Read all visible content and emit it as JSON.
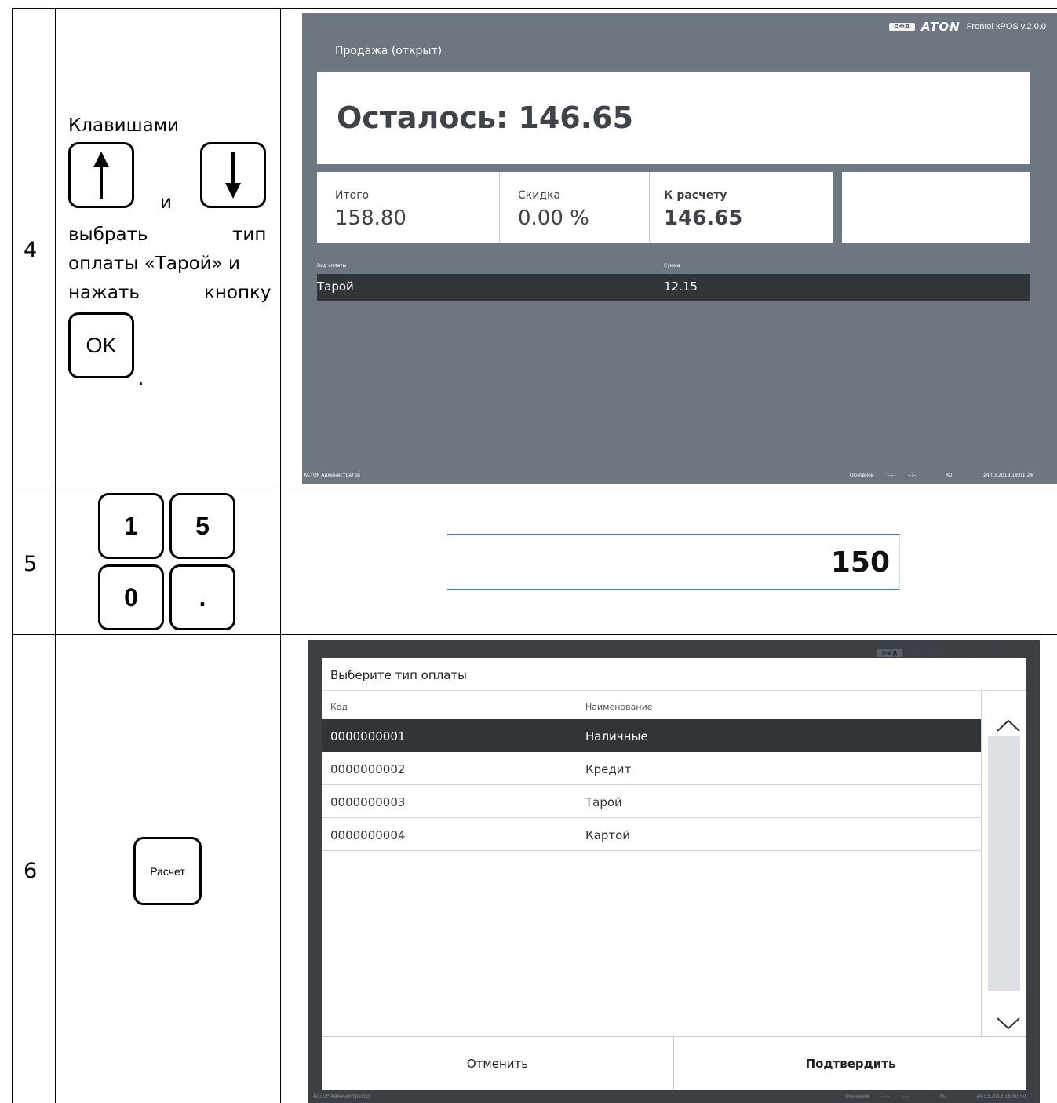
{
  "rows": [
    {
      "step": "4",
      "instruction": {
        "line1": "Клавишами",
        "and_word": "и",
        "line3_left": "выбрать",
        "line3_right": "тип",
        "line4": "оплаты «Тарой» и",
        "line5_left": "нажать",
        "line5_right": "кнопку",
        "ok_key": "OK",
        "period": "."
      },
      "keys": [
        "arrow-up-icon",
        "arrow-down-icon"
      ],
      "screen": {
        "brand": {
          "ofd_badge": "ОФД",
          "logo": "ATON",
          "version": "Frontol xPOS v.2.0.0"
        },
        "title": "Продажа (открыт)",
        "remaining": "Осталось: 146.65",
        "totals": [
          {
            "label": "Итого",
            "value": "158.80"
          },
          {
            "label": "Скидка",
            "value": "0.00 %"
          },
          {
            "label": "К расчету",
            "value": "146.65"
          }
        ],
        "payments_header": {
          "type": "Вид оплаты",
          "sum": "Сумма"
        },
        "payments": [
          {
            "type": "Тарой",
            "sum": "12.15"
          }
        ],
        "status": {
          "user": "АСТОР  Администратор",
          "mode": "Основной",
          "t1": "--:--",
          "t2": "--:--",
          "lang": "RU",
          "datetime": "24.03.2018 18:01:24"
        }
      }
    },
    {
      "step": "5",
      "keys": [
        "1",
        "5",
        "0",
        "."
      ],
      "amount": "150"
    },
    {
      "step": "6",
      "key_label": "Расчет",
      "screen": {
        "brand": {
          "ofd_badge": "ОФД",
          "logo": "ATON",
          "version": "Frontol xPOS v.2.0.0"
        },
        "dialog_title": "Выберите тип оплаты",
        "columns": {
          "code": "Код",
          "name": "Наименование"
        },
        "items": [
          {
            "code": "0000000001",
            "name": "Наличные"
          },
          {
            "code": "0000000002",
            "name": "Кредит"
          },
          {
            "code": "0000000003",
            "name": "Тарой"
          },
          {
            "code": "0000000004",
            "name": "Картой"
          }
        ],
        "selected_index": 0,
        "cancel_label": "Отменить",
        "confirm_label": "Подтвердить",
        "status": {
          "user": "АСТОР  Администратор",
          "mode": "Основной",
          "t1": "--:--",
          "t2": "--:--",
          "lang": "RU",
          "datetime": "24.03.2018 18:00:50"
        }
      }
    }
  ],
  "colors": {
    "screen_bg": "#6e7781",
    "dark_row": "#30353a",
    "accent_blue": "#3d7bd2",
    "text_dark": "#3e4349"
  }
}
